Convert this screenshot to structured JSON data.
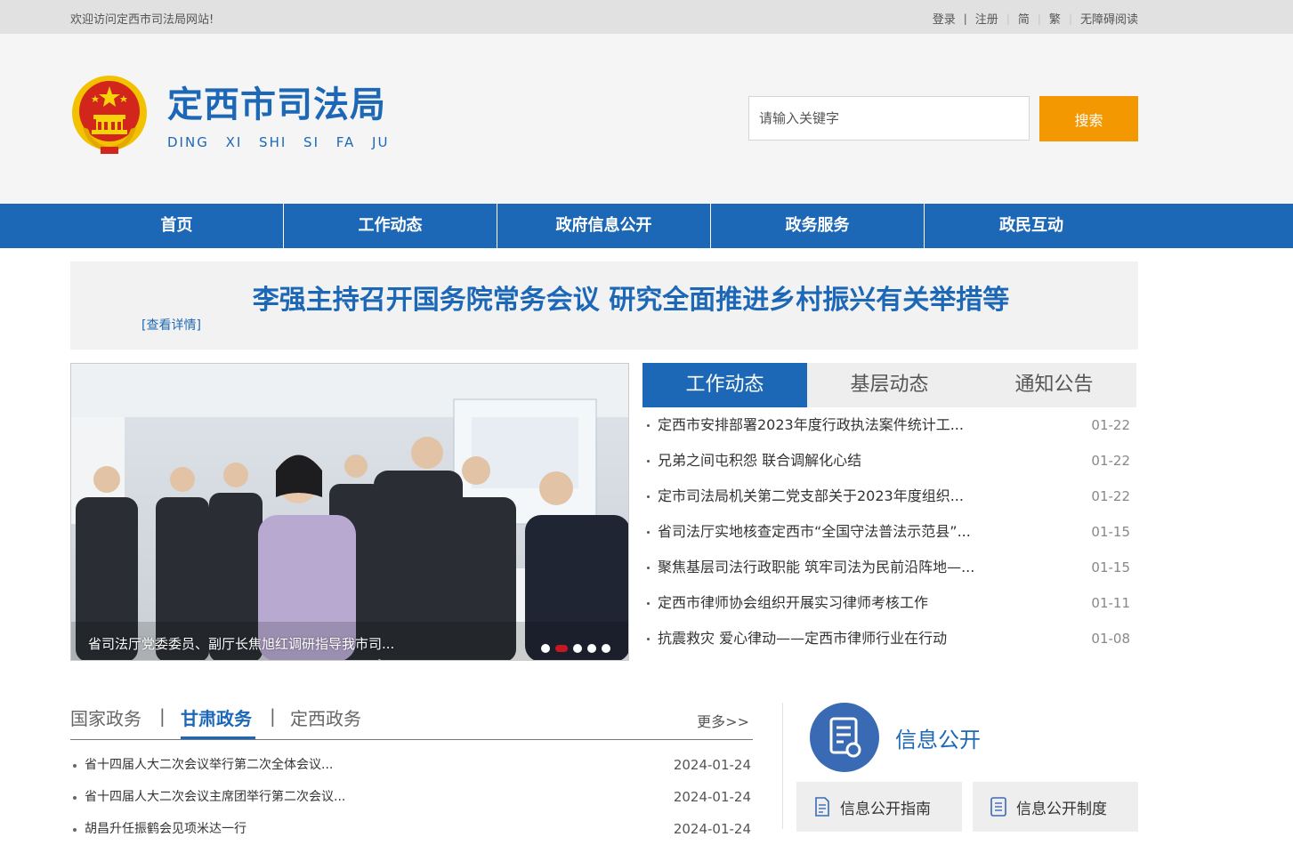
{
  "topbar": {
    "welcome": "欢迎访问定西市司法局网站!",
    "links": [
      "登录",
      "注册",
      "简",
      "繁",
      "无障碍阅读"
    ]
  },
  "header": {
    "title": "定西市司法局",
    "pinyin": "DING XI  SHI  SI  FA  JU",
    "search_placeholder": "请输入关键字",
    "search_button": "搜索"
  },
  "nav": [
    "首页",
    "工作动态",
    "政府信息公开",
    "政务服务",
    "政民互动"
  ],
  "headline": {
    "title": "李强主持召开国务院常务会议  研究全面推进乡村振兴有关举措等",
    "more": "[查看详情]"
  },
  "slider": {
    "caption": "省司法厅党委委员、副厅长焦旭红调研指导我市司...",
    "dot_count": 5,
    "active_dot": 1
  },
  "news": {
    "tabs": [
      "工作动态",
      "基层动态",
      "通知公告"
    ],
    "items": [
      {
        "title": "定西市安排部署2023年度行政执法案件统计工...",
        "date": "01-22"
      },
      {
        "title": "兄弟之间屯积怨 联合调解化心结",
        "date": "01-22"
      },
      {
        "title": "定市司法局机关第二党支部关于2023年度组织...",
        "date": "01-22"
      },
      {
        "title": "省司法厅实地核查定西市“全国守法普法示范县”...",
        "date": "01-15"
      },
      {
        "title": "聚焦基层司法行政职能 筑牢司法为民前沿阵地—...",
        "date": "01-15"
      },
      {
        "title": "定西市律师协会组织开展实习律师考核工作",
        "date": "01-11"
      },
      {
        "title": "抗震救灾 爱心律动——定西市律师行业在行动",
        "date": "01-08"
      }
    ]
  },
  "gov": {
    "tabs": [
      "国家政务",
      "甘肃政务",
      "定西政务"
    ],
    "more": "更多>>",
    "items": [
      {
        "title": "省十四届人大二次会议举行第二次全体会议...",
        "date": "2024-01-24"
      },
      {
        "title": "省十四届人大二次会议主席团举行第二次会议...",
        "date": "2024-01-24"
      },
      {
        "title": "胡昌升任振鹤会见项米达一行",
        "date": "2024-01-24"
      }
    ]
  },
  "info": {
    "title": "信息公开",
    "cards": [
      "信息公开指南",
      "信息公开制度"
    ]
  },
  "colors": {
    "primary": "#1d68b6",
    "accent": "#f39800",
    "dot_active": "#c81623"
  }
}
